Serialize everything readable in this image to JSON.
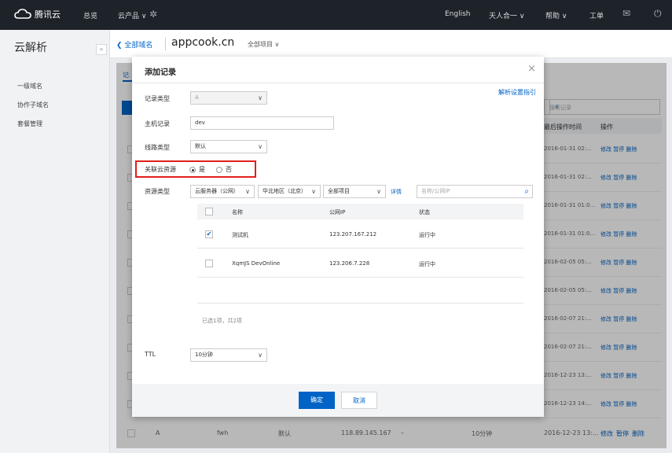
{
  "topbar": {
    "brand": "腾讯云",
    "nav_overview": "总览",
    "nav_products": "云产品",
    "lang": "English",
    "user": "天人合一",
    "help": "帮助",
    "ticket": "工单"
  },
  "sidebar": {
    "title": "云解析",
    "collapse": "«",
    "items": [
      "一级域名",
      "协作子域名",
      "套餐管理"
    ]
  },
  "header": {
    "back": "全部域名",
    "domain": "appcook.cn",
    "project": "全部项目"
  },
  "background": {
    "tab": "记",
    "search_placeholder": "搜索记录",
    "col_time": "最后操作时间",
    "col_ops": "操作",
    "op_edit": "修改",
    "op_pause": "暂停",
    "op_delete": "删除",
    "times": [
      "2016-01-31 02:...",
      "2016-01-31 02:...",
      "2016-01-31 01:0...",
      "2016-01-31 01:0...",
      "2016-02-05 05:...",
      "2016-02-05 05:...",
      "2016-02-07 21:...",
      "2016-02-07 21:...",
      "2016-12-23 13:...",
      "2016-12-23 14:..."
    ],
    "last_row": {
      "type": "A",
      "host": "fwh",
      "line": "默认",
      "value": "118.89.145.167",
      "mx": "–",
      "ttl": "10分钟",
      "time": "2016-12-23 13:..."
    }
  },
  "modal": {
    "title": "添加记录",
    "close": "×",
    "guide_link": "解析设置指引",
    "record_type_label": "记录类型",
    "record_type_value": "A",
    "host_label": "主机记录",
    "host_value": "dev",
    "line_label": "线路类型",
    "line_value": "默认",
    "link_label": "关联云资源",
    "link_yes": "是",
    "link_no": "否",
    "resource_label": "资源类型",
    "resource_type": "云服务器（公网）",
    "region": "华北地区（北京）",
    "project": "全部项目",
    "detail_link": "详情",
    "search_placeholder": "名称/公网IP",
    "table_headers": [
      "名称",
      "公网IP",
      "状态"
    ],
    "rows": [
      {
        "name": "测试机",
        "ip": "123.207.167.212",
        "status": "运行中",
        "checked": true
      },
      {
        "name": "XqmJS DevOnline",
        "ip": "123.206.7.228",
        "status": "运行中",
        "checked": false
      }
    ],
    "selection_summary": "已选1项，共2项",
    "ttl_label": "TTL",
    "ttl_value": "10分钟",
    "confirm": "确定",
    "cancel": "取消"
  },
  "colors": {
    "accent": "#0063c5",
    "highlight": "#e0201b",
    "topbar": "#1e2329"
  }
}
